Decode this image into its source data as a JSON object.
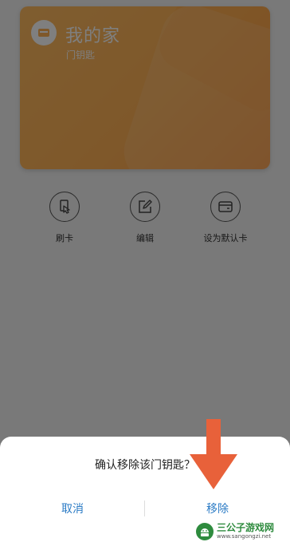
{
  "card": {
    "title": "我的家",
    "subtitle": "门钥匙",
    "icon": "card-icon",
    "color": "#ffb155"
  },
  "actions": [
    {
      "label": "刷卡",
      "icon": "swipe-card-icon"
    },
    {
      "label": "编辑",
      "icon": "edit-icon"
    },
    {
      "label": "设为默认卡",
      "icon": "default-card-icon"
    }
  ],
  "dialog": {
    "message": "确认移除该门钥匙？",
    "cancel_label": "取消",
    "remove_label": "移除",
    "accent_color": "#2b7bc5"
  },
  "annotation": {
    "icon": "arrow-down-icon",
    "color": "#e8613a"
  },
  "watermark": {
    "name": "三公子游戏网",
    "url": "www.sangongzi.net",
    "icon": "android-logo-icon"
  }
}
